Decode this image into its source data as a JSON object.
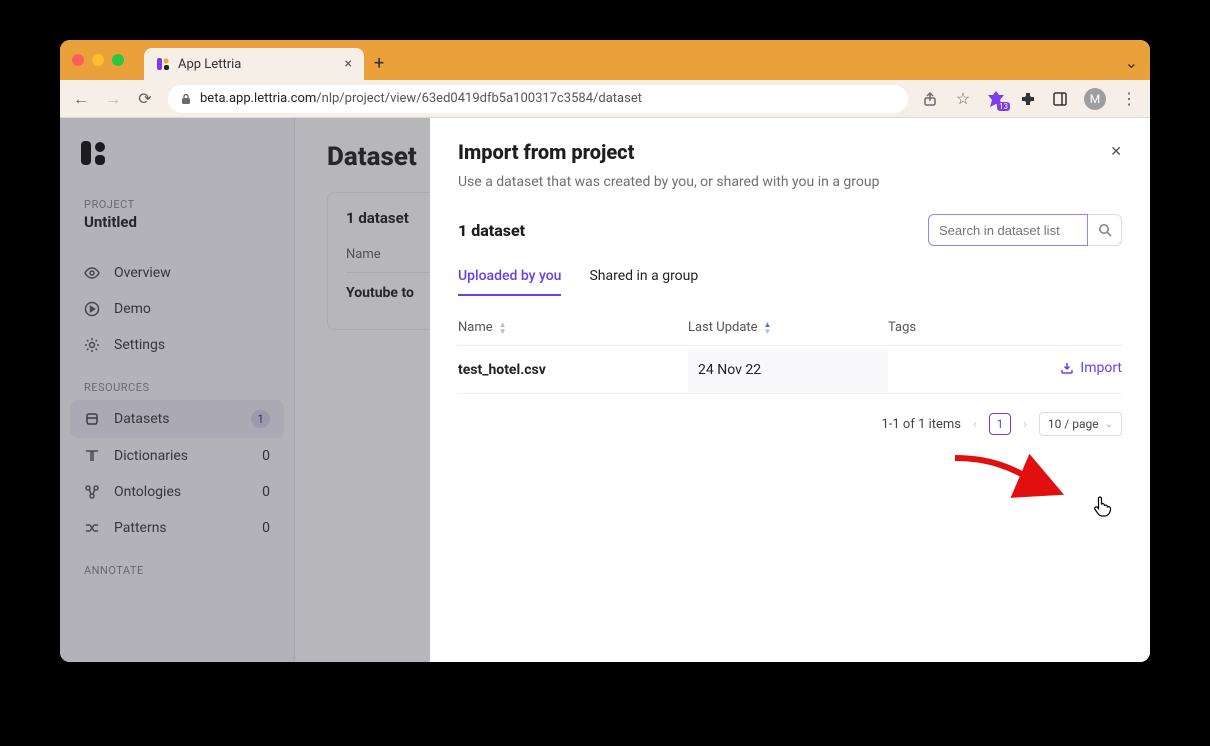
{
  "browser": {
    "tab_title": "App Lettria",
    "url_host": "beta.app.lettria.com",
    "url_path": "/nlp/project/view/63ed0419dfb5a100317c3584/dataset",
    "ext_badge": "13",
    "avatar_initial": "M"
  },
  "sidebar": {
    "project_label": "PROJECT",
    "project_title": "Untitled",
    "items_top": [
      {
        "icon": "eye",
        "label": "Overview"
      },
      {
        "icon": "play",
        "label": "Demo"
      },
      {
        "icon": "gear",
        "label": "Settings"
      }
    ],
    "resources_label": "RESOURCES",
    "items_resources": [
      {
        "icon": "stack",
        "label": "Datasets",
        "badge": "1",
        "active": true
      },
      {
        "icon": "book",
        "label": "Dictionaries",
        "count": "0"
      },
      {
        "icon": "nodes",
        "label": "Ontologies",
        "count": "0"
      },
      {
        "icon": "pattern",
        "label": "Patterns",
        "count": "0"
      }
    ],
    "annotate_label": "ANNOTATE"
  },
  "main": {
    "heading": "Dataset",
    "panel_title": "1 dataset",
    "col_name": "Name",
    "row0_name": "Youtube to"
  },
  "modal": {
    "title": "Import from project",
    "subtitle": "Use a dataset that was created by you, or shared with you in a group",
    "ds_count": "1 dataset",
    "search_placeholder": "Search in dataset list",
    "tabs": {
      "mine": "Uploaded by you",
      "shared": "Shared in a group"
    },
    "columns": {
      "name": "Name",
      "update": "Last Update",
      "tags": "Tags"
    },
    "rows": [
      {
        "name": "test_hotel.csv",
        "update": "24 Nov 22",
        "action": "Import"
      }
    ],
    "pager": {
      "summary": "1-1 of 1 items",
      "page": "1",
      "size": "10 / page"
    }
  }
}
